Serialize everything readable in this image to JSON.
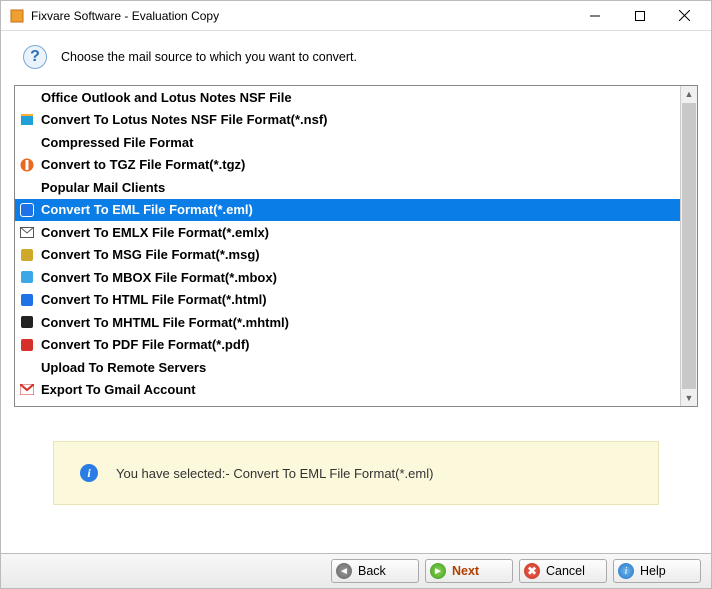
{
  "window": {
    "title": "Fixvare Software - Evaluation Copy"
  },
  "instruction": "Choose the mail source to which you want to convert.",
  "list": [
    {
      "kind": "header",
      "label": "Office Outlook and Lotus Notes NSF File"
    },
    {
      "kind": "item",
      "icon": "lotus-note-icon",
      "color": "#1fa0d8",
      "label": "Convert To Lotus Notes NSF File Format(*.nsf)"
    },
    {
      "kind": "header",
      "label": "Compressed File Format"
    },
    {
      "kind": "item",
      "icon": "tgz-icon",
      "color": "#e96a1f",
      "label": "Convert to TGZ File Format(*.tgz)"
    },
    {
      "kind": "header",
      "label": "Popular Mail Clients"
    },
    {
      "kind": "item",
      "icon": "eml-icon",
      "color": "#1f72e6",
      "label": "Convert To EML File Format(*.eml)",
      "selected": true
    },
    {
      "kind": "item",
      "icon": "emlx-icon",
      "color": "#555",
      "label": "Convert To EMLX File Format(*.emlx)"
    },
    {
      "kind": "item",
      "icon": "msg-icon",
      "color": "#cfa92a",
      "label": "Convert To MSG File Format(*.msg)"
    },
    {
      "kind": "item",
      "icon": "mbox-icon",
      "color": "#3aa7e6",
      "label": "Convert To MBOX File Format(*.mbox)"
    },
    {
      "kind": "item",
      "icon": "html-icon",
      "color": "#1f72e6",
      "label": "Convert To HTML File Format(*.html)"
    },
    {
      "kind": "item",
      "icon": "mhtml-icon",
      "color": "#222",
      "label": "Convert To MHTML File Format(*.mhtml)"
    },
    {
      "kind": "item",
      "icon": "pdf-icon",
      "color": "#d6302a",
      "label": "Convert To PDF File Format(*.pdf)"
    },
    {
      "kind": "header",
      "label": "Upload To Remote Servers"
    },
    {
      "kind": "item",
      "icon": "gmail-icon",
      "color": "#d6302a",
      "label": "Export To Gmail Account"
    }
  ],
  "status": {
    "prefix": "You have selected:- ",
    "selection": "Convert To EML File Format(*.eml)"
  },
  "buttons": {
    "back": "Back",
    "next": "Next",
    "cancel": "Cancel",
    "help": "Help"
  }
}
